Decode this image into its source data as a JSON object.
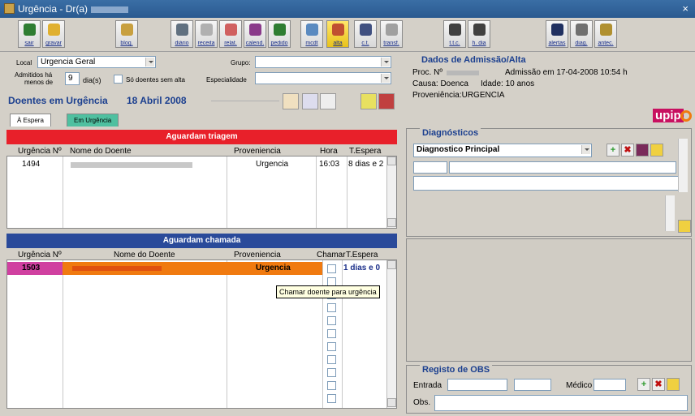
{
  "window": {
    "title": "Urgência - Dr(a)",
    "close": "×"
  },
  "toolbar": {
    "buttons": [
      {
        "label": "sair",
        "color": "#2e7d32"
      },
      {
        "label": "gravar",
        "color": "#e0b030"
      },
      {
        "label": "blog.",
        "color": "#c8a040"
      },
      {
        "label": "diário",
        "color": "#607080"
      },
      {
        "label": "receita",
        "color": "#b0b0b0"
      },
      {
        "label": "relat.",
        "color": "#d06060"
      },
      {
        "label": "calend.",
        "color": "#8a3a8a"
      },
      {
        "label": "pedido",
        "color": "#2e7d32"
      },
      {
        "label": "mcdt",
        "color": "#5a8ac0"
      },
      {
        "label": "alta",
        "color": "#c05030"
      },
      {
        "label": "c.t.",
        "color": "#405080"
      },
      {
        "label": "transf.",
        "color": "#a0a0a0"
      },
      {
        "label": "t.t.c.",
        "color": "#404040"
      },
      {
        "label": "h. dia",
        "color": "#404040"
      },
      {
        "label": "alertas",
        "color": "#203060"
      },
      {
        "label": "diag.",
        "color": "#707070"
      },
      {
        "label": "antec.",
        "color": "#b09030"
      }
    ]
  },
  "filters": {
    "local_label": "Local",
    "local_value": "Urgencia Geral",
    "grupo_label": "Grupo:",
    "admitidos_label_1": "Admitidos há",
    "admitidos_label_2": "menos de",
    "admitidos_value": "9",
    "dias_label": "dia(s)",
    "so_doentes_label": "Só doentes sem alta",
    "especialidade_label": "Especialidade"
  },
  "main": {
    "title": "Doentes em Urgência",
    "date": "18 Abril 2008"
  },
  "tabs": [
    {
      "label": "À Espera"
    },
    {
      "label": "Em Urgência"
    }
  ],
  "triagem": {
    "band": "Aguardam triagem",
    "band_color": "#e8202a",
    "columns": [
      "Urgência Nº",
      "Nome do Doente",
      "Proveniencia",
      "Hora",
      "T.Espera"
    ],
    "rows": [
      {
        "num": "1494",
        "prov": "Urgencia",
        "hora": "16:03",
        "espera": "8 dias e 2"
      }
    ]
  },
  "chamada": {
    "band": "Aguardam chamada",
    "band_color": "#2a4a9a",
    "columns": [
      "Urgência Nº",
      "Nome do Doente",
      "Proveniencia",
      "Chamar",
      "T.Espera"
    ],
    "rows": [
      {
        "num": "1503",
        "prov": "Urgencia",
        "espera": "1 dias e 0"
      }
    ],
    "tooltip": "Chamar doente para urgência"
  },
  "admissao": {
    "title": "Dados de Admissão/Alta",
    "proc_label": "Proc. Nº",
    "admissao_text": "Admissão em 17-04-2008 10:54 h",
    "causa": "Causa: Doenca",
    "idade": "Idade: 10 anos",
    "proveniencia": "Proveniência:URGENCIA",
    "logo": "upip"
  },
  "diagnosticos": {
    "title": "Diagnósticos",
    "selected": "Diagnostico Principal"
  },
  "obs": {
    "title": "Registo de OBS",
    "entrada_label": "Entrada",
    "medico_label": "Médico",
    "obs_label": "Obs."
  }
}
